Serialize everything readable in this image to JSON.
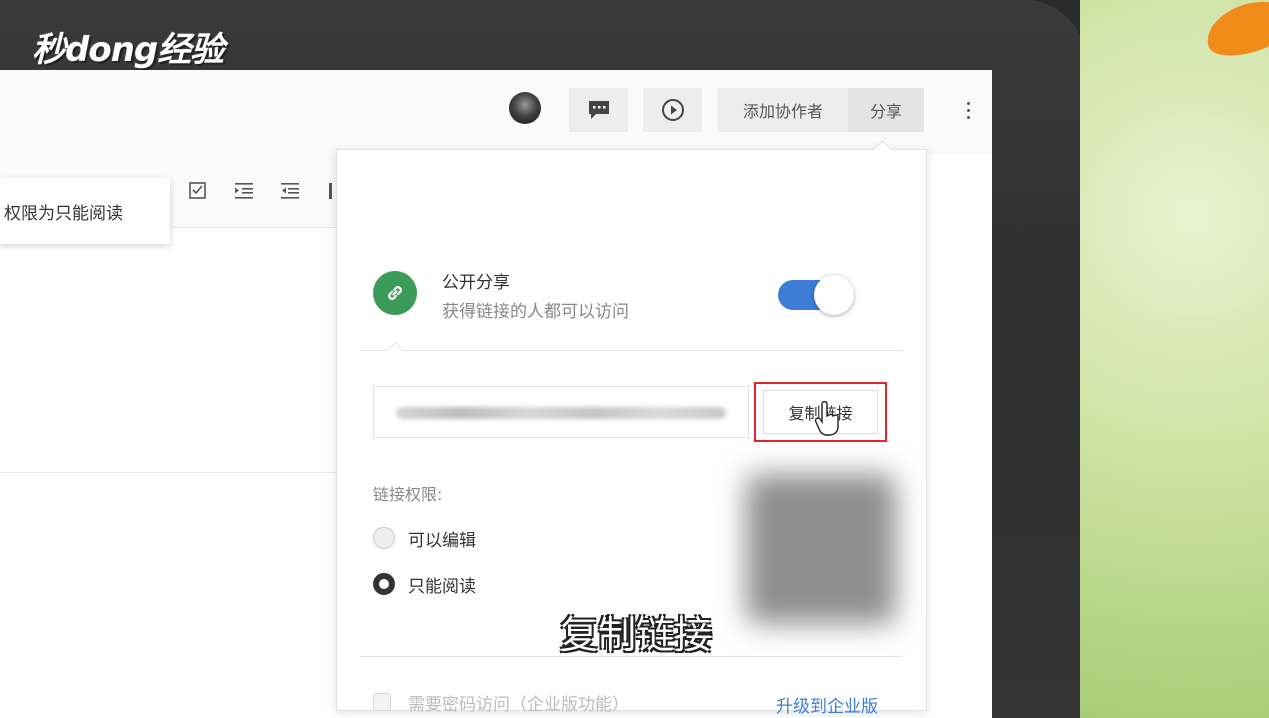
{
  "watermark": {
    "text": "秒dong经验"
  },
  "window": {
    "controls": {
      "minimize": "—",
      "maximize": "☐",
      "close": "✕"
    }
  },
  "toolbar": {
    "collaborator_button": "添加协作者",
    "share_button": "分享"
  },
  "editor": {
    "tooltip_text": "权限为只能阅读"
  },
  "share_panel": {
    "title": "公开分享",
    "subtitle": "获得链接的人都可以访问",
    "public_toggle_on": true,
    "copy_link_button": "复制链接",
    "permission_label": "链接权限:",
    "permission_options": [
      {
        "label": "可以编辑",
        "selected": false
      },
      {
        "label": "只能阅读",
        "selected": true
      }
    ],
    "password_option": "需要密码访问（企业版功能）",
    "upgrade_link": "升级到企业版"
  },
  "caption": "复制链接",
  "colors": {
    "accent_blue": "#3d7dd8",
    "link_icon_green": "#3c9b59",
    "highlight_red": "#e0252b"
  }
}
